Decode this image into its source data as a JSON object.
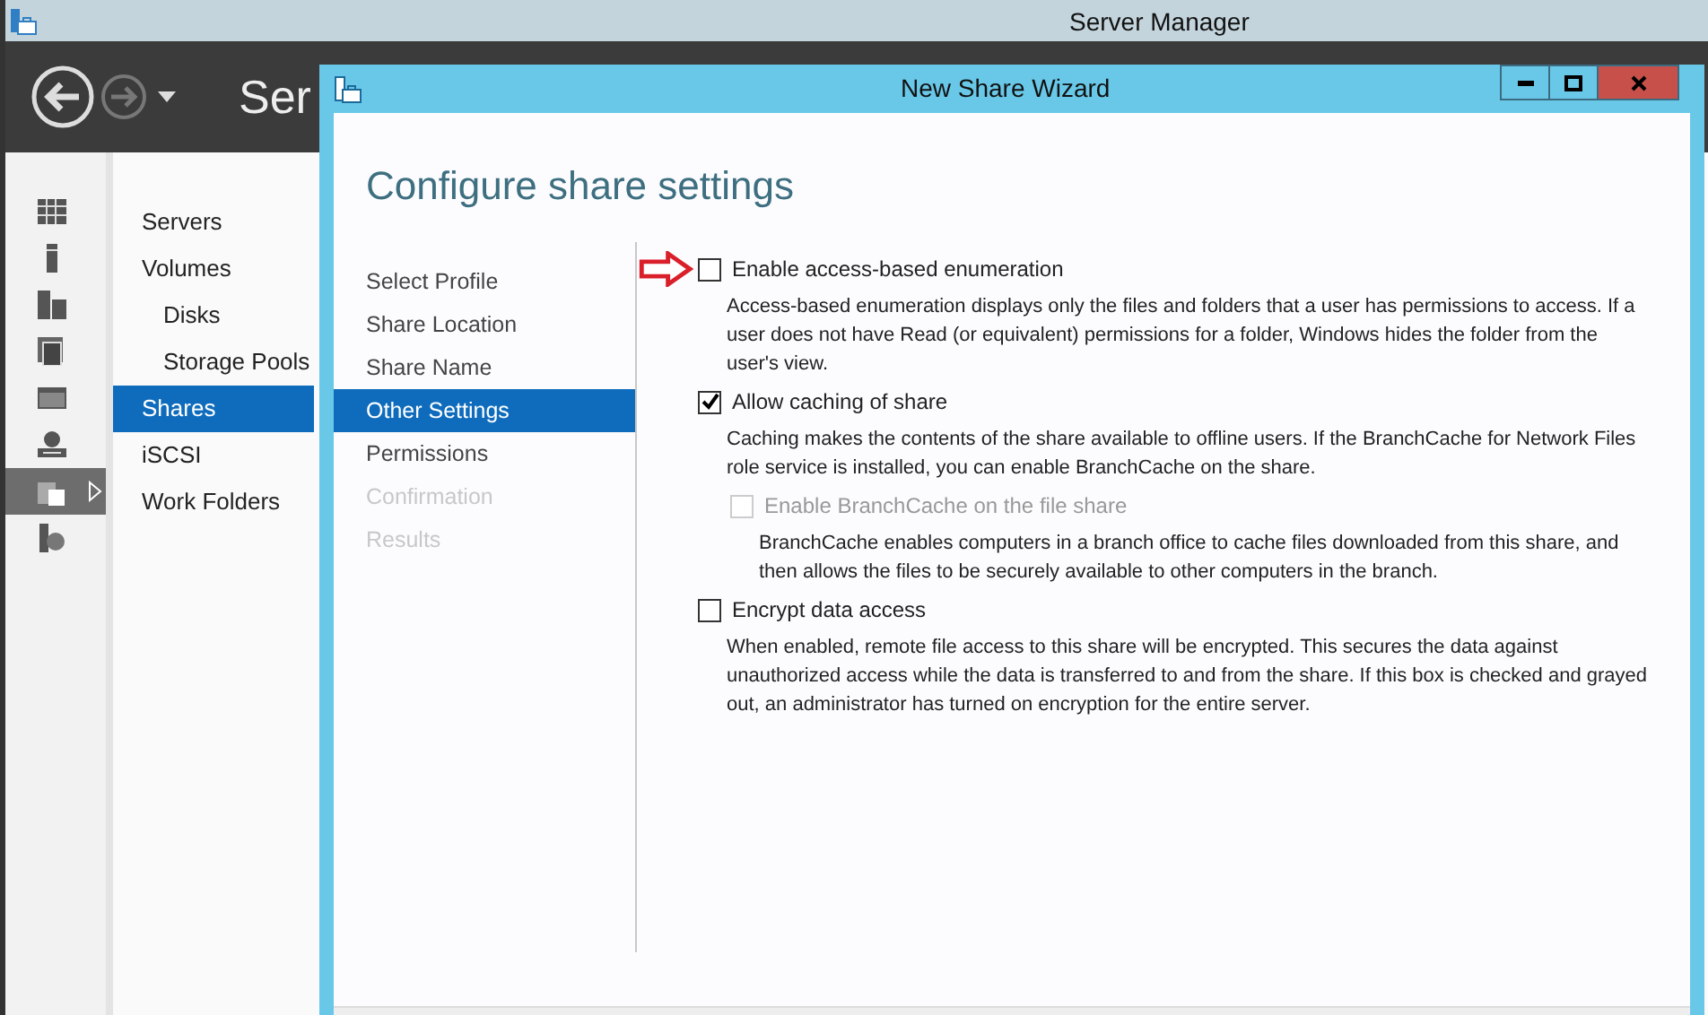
{
  "window": {
    "title": "Server Manager",
    "header_title": "Ser"
  },
  "sidebar": {
    "icons": [
      {
        "selected": false
      },
      {
        "selected": false
      },
      {
        "selected": false
      },
      {
        "selected": false
      },
      {
        "selected": false
      },
      {
        "selected": false
      },
      {
        "selected": true
      },
      {
        "selected": false
      }
    ]
  },
  "nav": {
    "items": [
      {
        "label": "Servers",
        "selected": false
      },
      {
        "label": "Volumes",
        "selected": false,
        "children": [
          {
            "label": "Disks",
            "selected": false
          },
          {
            "label": "Storage Pools",
            "selected": false
          }
        ]
      },
      {
        "label": "Shares",
        "selected": true
      },
      {
        "label": "iSCSI",
        "selected": false
      },
      {
        "label": "Work Folders",
        "selected": false
      }
    ]
  },
  "dialog": {
    "title": "New Share Wizard",
    "heading": "Configure share settings",
    "steps": [
      {
        "label": "Select Profile",
        "selected": false,
        "disabled": false
      },
      {
        "label": "Share Location",
        "selected": false,
        "disabled": false
      },
      {
        "label": "Share Name",
        "selected": false,
        "disabled": false
      },
      {
        "label": "Other Settings",
        "selected": true,
        "disabled": false
      },
      {
        "label": "Permissions",
        "selected": false,
        "disabled": false
      },
      {
        "label": "Confirmation",
        "selected": false,
        "disabled": true
      },
      {
        "label": "Results",
        "selected": false,
        "disabled": true
      }
    ],
    "options": [
      {
        "label": "Enable access-based enumeration",
        "checked": false,
        "disabled": false,
        "annotated": true,
        "description": "Access-based enumeration displays only the files and folders that a user has permissions to access. If a user does not have Read (or equivalent) permissions for a folder, Windows hides the folder from the user's view."
      },
      {
        "label": "Allow caching of share",
        "checked": true,
        "disabled": false,
        "annotated": false,
        "description": "Caching makes the contents of the share available to offline users. If the BranchCache for Network Files role service is installed, you can enable BranchCache on the share.",
        "children": [
          {
            "label": "Enable BranchCache on the file share",
            "checked": false,
            "disabled": true,
            "annotated": false,
            "description": "BranchCache enables computers in a branch office to cache files downloaded from this share, and then allows the files to be securely available to other computers in the branch."
          }
        ]
      },
      {
        "label": "Encrypt data access",
        "checked": false,
        "disabled": false,
        "annotated": false,
        "description": "When enabled, remote file access to this share will be encrypted. This secures the data against unauthorized access while the data is transferred to and from the share. If this box is checked and grayed out, an administrator has turned on encryption for the entire server."
      }
    ]
  }
}
